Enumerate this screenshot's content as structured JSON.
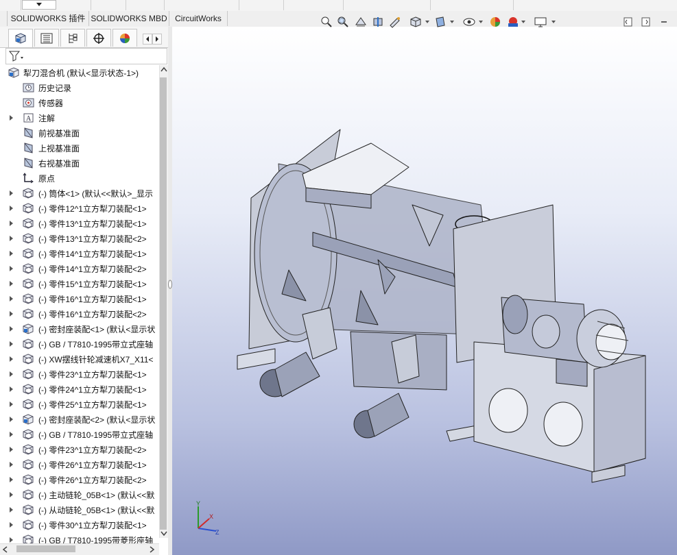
{
  "tabs": {
    "command_manager": [
      "SOLIDWORKS 插件",
      "SOLIDWORKS MBD",
      "CircuitWorks"
    ]
  },
  "panel": {
    "tab_icons": [
      "part-icon",
      "property-manager-icon",
      "configuration-manager-icon",
      "dimxpert-icon",
      "display-manager-icon"
    ],
    "filter_icon": "funnel-icon"
  },
  "tree": {
    "root": "犁刀混合机 (默认<显示状态-1>)",
    "items": [
      {
        "label": "历史记录",
        "icon": "history-icon",
        "expandable": false
      },
      {
        "label": "传感器",
        "icon": "sensor-icon",
        "expandable": false
      },
      {
        "label": "注解",
        "icon": "annotation-icon",
        "expandable": true
      },
      {
        "label": "前视基准面",
        "icon": "plane-icon",
        "expandable": false
      },
      {
        "label": "上视基准面",
        "icon": "plane-icon",
        "expandable": false
      },
      {
        "label": "右视基准面",
        "icon": "plane-icon",
        "expandable": false
      },
      {
        "label": "原点",
        "icon": "origin-icon",
        "expandable": false
      },
      {
        "label": "(-) 筒体<1> (默认<<默认>_显示",
        "icon": "part-icon",
        "expandable": true
      },
      {
        "label": "(-) 零件12^1立方犁刀装配<1>",
        "icon": "part-icon",
        "expandable": true
      },
      {
        "label": "(-) 零件13^1立方犁刀装配<1>",
        "icon": "part-icon",
        "expandable": true
      },
      {
        "label": "(-) 零件13^1立方犁刀装配<2>",
        "icon": "part-icon",
        "expandable": true
      },
      {
        "label": "(-) 零件14^1立方犁刀装配<1>",
        "icon": "part-icon",
        "expandable": true
      },
      {
        "label": "(-) 零件14^1立方犁刀装配<2>",
        "icon": "part-icon",
        "expandable": true
      },
      {
        "label": "(-) 零件15^1立方犁刀装配<1>",
        "icon": "part-icon",
        "expandable": true
      },
      {
        "label": "(-) 零件16^1立方犁刀装配<1>",
        "icon": "part-icon",
        "expandable": true
      },
      {
        "label": "(-) 零件16^1立方犁刀装配<2>",
        "icon": "part-icon",
        "expandable": true
      },
      {
        "label": "(-) 密封座装配<1> (默认<显示状",
        "icon": "assembly-icon",
        "expandable": true
      },
      {
        "label": "(-) GB / T7810-1995带立式座轴",
        "icon": "part-icon",
        "expandable": true
      },
      {
        "label": "(-) XW摆线针轮减速机X7_X11<",
        "icon": "part-icon",
        "expandable": true
      },
      {
        "label": "(-) 零件23^1立方犁刀装配<1>",
        "icon": "part-icon",
        "expandable": true
      },
      {
        "label": "(-) 零件24^1立方犁刀装配<1>",
        "icon": "part-icon",
        "expandable": true
      },
      {
        "label": "(-) 零件25^1立方犁刀装配<1>",
        "icon": "part-icon",
        "expandable": true
      },
      {
        "label": "(-) 密封座装配<2> (默认<显示状",
        "icon": "assembly-icon",
        "expandable": true
      },
      {
        "label": "(-) GB / T7810-1995带立式座轴",
        "icon": "part-icon",
        "expandable": true
      },
      {
        "label": "(-) 零件23^1立方犁刀装配<2>",
        "icon": "part-icon",
        "expandable": true
      },
      {
        "label": "(-) 零件26^1立方犁刀装配<1>",
        "icon": "part-icon",
        "expandable": true
      },
      {
        "label": "(-) 零件26^1立方犁刀装配<2>",
        "icon": "part-icon",
        "expandable": true
      },
      {
        "label": "(-) 主动链轮_05B<1> (默认<<默",
        "icon": "part-icon",
        "expandable": true
      },
      {
        "label": "(-) 从动链轮_05B<1> (默认<<默",
        "icon": "part-icon",
        "expandable": true
      },
      {
        "label": "(-) 零件30^1立方犁刀装配<1>",
        "icon": "part-icon",
        "expandable": true
      },
      {
        "label": "(-) GB / T7810-1995带菱形座轴",
        "icon": "part-icon",
        "expandable": true
      }
    ]
  },
  "heads_up": [
    "zoom-to-fit-icon",
    "zoom-area-icon",
    "previous-view-icon",
    "section-view-icon",
    "dynamic-annotation-icon",
    "view-orientation-icon",
    "display-style-icon",
    "hide-show-icon",
    "edit-appearance-icon",
    "apply-scene-icon",
    "view-settings-icon"
  ],
  "triad": {
    "x": "X",
    "y": "Y",
    "z": "Z"
  }
}
